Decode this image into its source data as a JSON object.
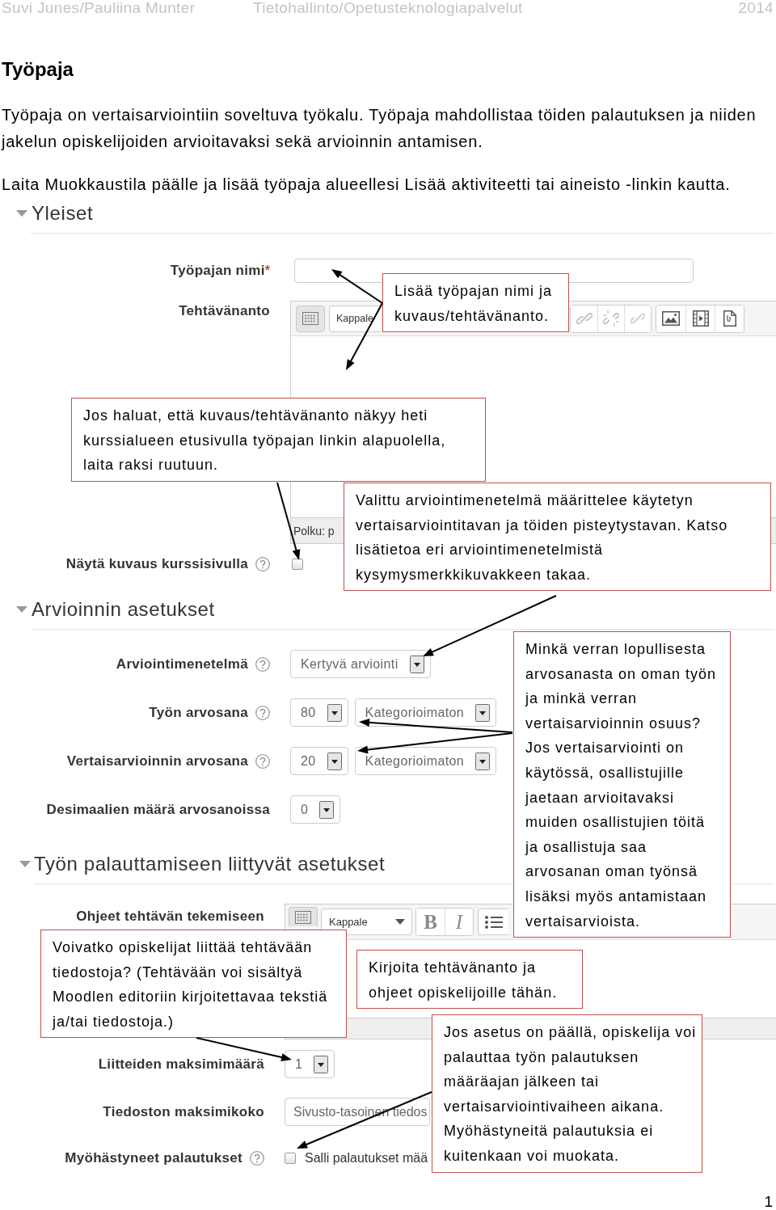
{
  "header": {
    "authors": "Suvi Junes/Pauliina Munter",
    "department": "Tietohallinto/Opetusteknologiapalvelut",
    "year": "2014"
  },
  "title": "Työpaja",
  "paragraphs": [
    "Työpaja on vertaisarviointiin soveltuva työkalu. Työpaja mahdollistaa töiden palautuksen ja niiden jakelun opiskelijoiden arvioitavaksi sekä arvioinnin antamisen.",
    "Laita Muokkaustila päälle ja lisää työpaja alueellesi Lisää aktiviteetti tai aineisto -linkin kautta."
  ],
  "form": {
    "sections": [
      {
        "title": "Yleiset",
        "expanded": true,
        "fields": [
          {
            "kind": "text",
            "label": "Työpajan nimi",
            "required_mark": "*",
            "help": false
          },
          {
            "kind": "editor",
            "label": "Tehtävänanto",
            "help": false,
            "format": "Kappale",
            "path": "Polku: p"
          },
          {
            "kind": "checkbox",
            "label": "Näytä kuvaus kurssisivulla",
            "help": true,
            "checked": false
          }
        ]
      },
      {
        "title": "Arvioinnin asetukset",
        "expanded": true,
        "fields": [
          {
            "kind": "select",
            "label": "Arviointimenetelmä",
            "help": true,
            "selects": [
              "Kertyvä arviointi"
            ]
          },
          {
            "kind": "select",
            "label": "Työn arvosana",
            "help": true,
            "selects": [
              "80",
              "Kategorioimaton"
            ]
          },
          {
            "kind": "select",
            "label": "Vertaisarvioinnin arvosana",
            "help": true,
            "selects": [
              "20",
              "Kategorioimaton"
            ]
          },
          {
            "kind": "select",
            "label": "Desimaalien määrä arvosanoissa",
            "help": false,
            "selects": [
              "0"
            ]
          }
        ]
      },
      {
        "title": "Työn palauttamiseen liittyvät asetukset",
        "expanded": true,
        "fields": [
          {
            "kind": "editor",
            "label": "Ohjeet tehtävän tekemiseen",
            "help": false,
            "format": "Kappale",
            "buttons": [
              "B",
              "I"
            ]
          },
          {
            "kind": "select",
            "label": "Liitteiden maksimimäärä",
            "help": false,
            "selects": [
              "1"
            ]
          },
          {
            "kind": "wide-select",
            "label": "Tiedoston maksimikoko",
            "help": false,
            "selects": [
              "Sivusto-tasoinen tiedos"
            ]
          },
          {
            "kind": "checkbox",
            "label": "Myöhästyneet palautukset",
            "help": true,
            "checked": false,
            "option": "Salli palautukset mää"
          }
        ]
      }
    ]
  },
  "callouts": [
    "Lisää työpajan nimi ja\nkuvaus/tehtävänanto.",
    "Jos haluat, että kuvaus/tehtävänanto näkyy heti\nkurssialueen etusivulla työpajan linkin alapuolella,\nlaita raksi ruutuun.",
    "Valittu arviointimenetelmä määrittelee käytetyn\nvertaisarviointitavan ja töiden pisteytystavan. Katso\nlisätietoa eri arviointimenetelmistä\nkysymysmerkkikuvakkeen takaa.",
    "Minkä verran lopullisesta\narvosanasta on oman työn\nja minkä verran\nvertaisarvioinnin osuus?\nJos vertaisarviointi on\nkäytössä, osallistujille\njaetaan arvioitavaksi\nmuiden osallistujien töitä\nja osallistuja saa\narvosanan oman työnsä\nlisäksi myös antamistaan\nvertaisarvioista.",
    "Voivatko opiskelijat liittää tehtävään\ntiedostoja? (Tehtävään voi sisältyä\nMoodlen editoriin kirjoitettavaa tekstiä\nja/tai tiedostoja.)",
    "Kirjoita tehtävänanto ja\nohjeet opiskelijoille tähän.",
    "Jos asetus on päällä, opiskelija voi\npalauttaa työn palautuksen\nmääräajan jälkeen tai\nvertaisarviointivaiheen aikana.\nMyöhästyneitä palautuksia ei\nkuitenkaan voi muokata."
  ],
  "page_number": "1"
}
